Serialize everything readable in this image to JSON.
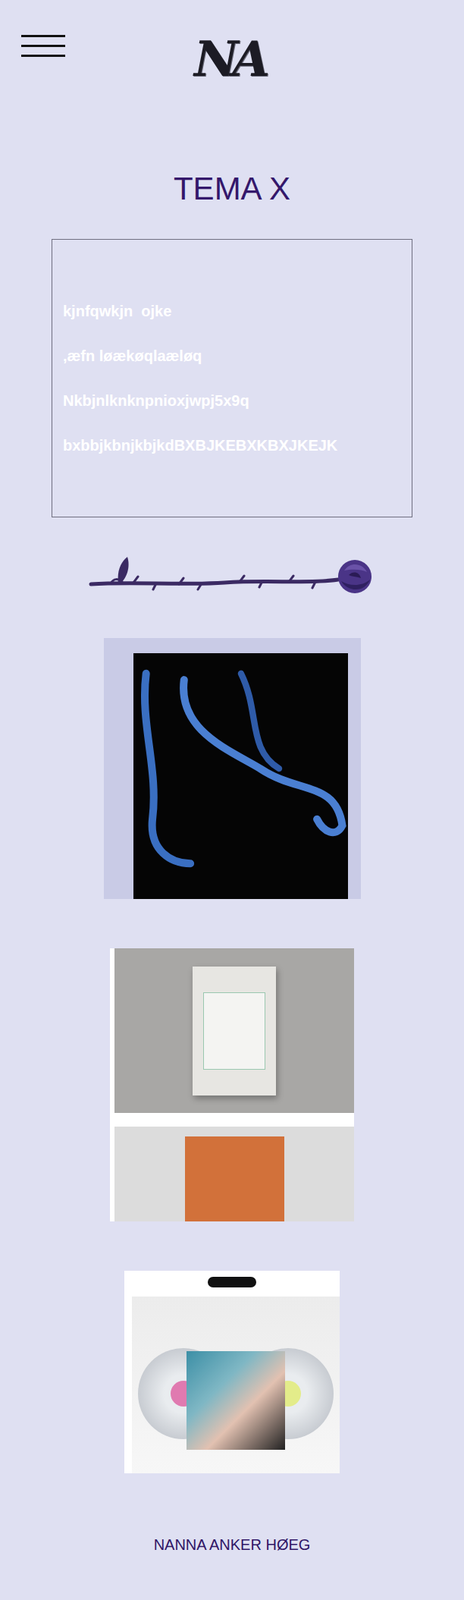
{
  "header": {
    "logo": "NA"
  },
  "title": "TEMA X",
  "text_box": {
    "lines": [
      "kjnfqwkjn  ojke",
      ",æfn løækøqlaæløq",
      "Nkbjnlknknpnioxjwpj5x9q",
      "bxbbjkbnjkbjkdBXBJKEBXKBXJKEJK"
    ]
  },
  "gallery": [
    {
      "kind": "poster"
    },
    {
      "kind": "packaging"
    },
    {
      "kind": "vinyl"
    }
  ],
  "footer": {
    "name": "NANNA ANKER HØEG"
  }
}
